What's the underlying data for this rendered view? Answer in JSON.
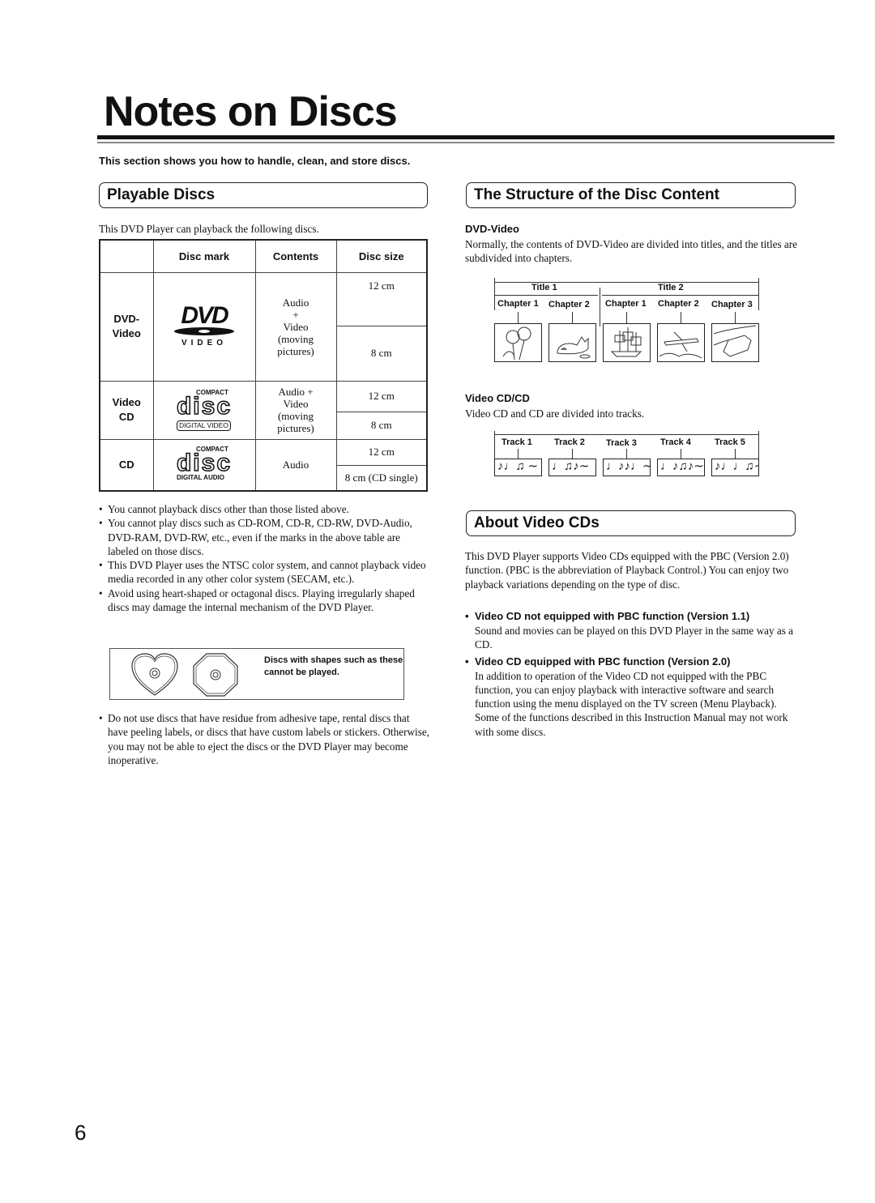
{
  "page": {
    "title": "Notes on Discs",
    "intro": "This section shows you how to handle, clean, and store discs.",
    "page_number": "6"
  },
  "playable": {
    "heading": "Playable Discs",
    "intro": "This DVD Player can playback the following discs.",
    "table": {
      "headers": [
        "",
        "Disc mark",
        "Contents",
        "Disc size"
      ],
      "rows": [
        {
          "type": "DVD-Video",
          "type_line1": "DVD-",
          "type_line2": "Video",
          "mark": {
            "icon": "dvd-video-logo",
            "main": "DVD",
            "sub": "VIDEO"
          },
          "contents_lines": [
            "Audio",
            "+",
            "Video",
            "(moving",
            "pictures)"
          ],
          "sizes": [
            "12 cm",
            "8 cm"
          ]
        },
        {
          "type": "Video CD",
          "type_line1": "Video",
          "type_line2": "CD",
          "mark": {
            "icon": "compact-disc-digital-video-logo",
            "top": "COMPACT",
            "main": "disc",
            "sub": "DIGITAL VIDEO"
          },
          "contents_lines": [
            "Audio +",
            "Video",
            "(moving",
            "pictures)"
          ],
          "sizes": [
            "12 cm",
            "8 cm"
          ]
        },
        {
          "type": "CD",
          "type_line1": "CD",
          "type_line2": "",
          "mark": {
            "icon": "compact-disc-digital-audio-logo",
            "top": "COMPACT",
            "main": "disc",
            "sub": "DIGITAL AUDIO"
          },
          "contents_lines": [
            "Audio"
          ],
          "sizes": [
            "12 cm",
            "8 cm (CD single)"
          ]
        }
      ]
    },
    "bullets": [
      "You cannot playback discs other than those listed above.",
      "You cannot play discs such as CD-ROM,  CD-R, CD-RW, DVD-Audio, DVD-RAM, DVD-RW, etc., even if the marks in the above table are labeled on those discs.",
      "This DVD Player uses the NTSC color system, and cannot playback video media recorded in any other color system (SECAM, etc.).",
      "Avoid using heart-shaped or octagonal discs. Playing irregularly shaped discs may damage the internal mechanism of the DVD Player."
    ],
    "shape_note": "Discs with shapes such as these cannot be played.",
    "shape_icons": [
      "heart-shaped-disc-icon",
      "octagonal-disc-icon"
    ],
    "bullets_after": [
      "Do not use discs that have residue from adhesive tape, rental discs that have peeling labels, or discs that have custom labels or stickers. Otherwise, you may not be able to eject the discs or the DVD Player may become inoperative."
    ]
  },
  "structure": {
    "heading": "The Structure of the Disc Content",
    "dvd": {
      "subheading": "DVD-Video",
      "text": "Normally, the contents of DVD-Video are divided into titles, and the titles are subdivided into chapters.",
      "titles": [
        {
          "label": "Title 1",
          "chapters": [
            {
              "label": "Chapter 1",
              "image": "sunflowers-image"
            },
            {
              "label": "Chapter 2",
              "image": "cat-image"
            }
          ]
        },
        {
          "label": "Title 2",
          "chapters": [
            {
              "label": "Chapter 1",
              "image": "sailing-ship-image"
            },
            {
              "label": "Chapter 2",
              "image": "airplane-image"
            },
            {
              "label": "Chapter 3",
              "image": "car-image"
            }
          ]
        }
      ]
    },
    "vcd": {
      "subheading": "Video CD/CD",
      "text": "Video CD and CD are divided into tracks.",
      "tracks": [
        {
          "label": "Track 1",
          "notes": "♪♩♫ ∼"
        },
        {
          "label": "Track 2",
          "notes": "♩♫♪∼"
        },
        {
          "label": "Track 3",
          "notes": "♩♪♪♩∼"
        },
        {
          "label": "Track 4",
          "notes": "♩♪♫♪∼"
        },
        {
          "label": "Track 5",
          "notes": "♪♩♩♫∼"
        }
      ]
    }
  },
  "about_vcd": {
    "heading": "About Video CDs",
    "intro": "This DVD Player supports Video CDs equipped with the PBC (Version 2.0) function. (PBC is the abbreviation of Playback Control.) You can enjoy two playback variations depending on the type of disc.",
    "items": [
      {
        "title": "Video CD not equipped with PBC function (Version 1.1)",
        "text": "Sound and movies can be played on this DVD Player in the same way as a CD."
      },
      {
        "title": "Video CD equipped with PBC function (Version 2.0)",
        "text": "In addition to operation of the Video CD not equipped with the PBC function, you can enjoy playback with interactive software and search function using the menu displayed on the TV screen (Menu Playback). Some of the functions described in this Instruction Manual may not work with some discs."
      }
    ]
  }
}
